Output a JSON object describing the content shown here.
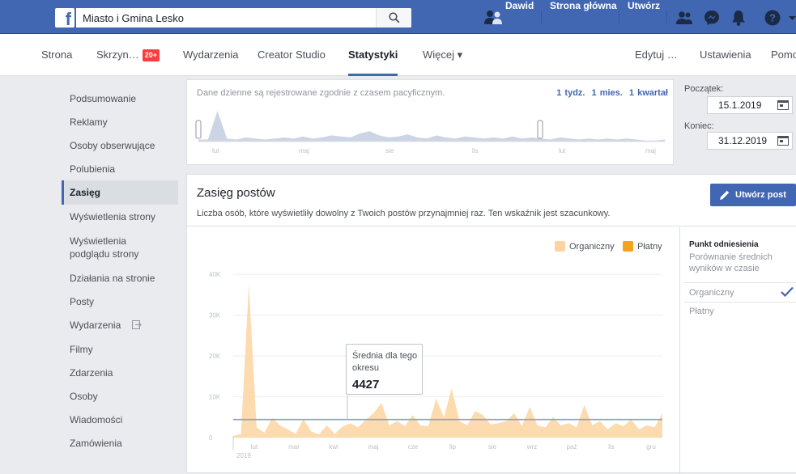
{
  "topbar": {
    "search_value": "Miasto i Gmina Lesko",
    "user_name": "Dawid",
    "home_label": "Strona główna",
    "create_label": "Utwórz",
    "icons": [
      "friends-icon",
      "messenger-icon",
      "bell-icon",
      "help-icon"
    ]
  },
  "page_nav": {
    "items": [
      {
        "label": "Strona"
      },
      {
        "label": "Skrzyn…",
        "badge": "20+"
      },
      {
        "label": "Wydarzenia"
      },
      {
        "label": "Creator Studio"
      },
      {
        "label": "Statystyki",
        "active": true
      },
      {
        "label": "Więcej ▾"
      }
    ],
    "right": [
      {
        "label": "Edytuj …"
      },
      {
        "label": "Ustawienia"
      },
      {
        "label": "Pomo"
      }
    ]
  },
  "sidebar": {
    "items": [
      {
        "label": "Podsumowanie"
      },
      {
        "label": "Reklamy"
      },
      {
        "label": "Osoby obserwujące"
      },
      {
        "label": "Polubienia"
      },
      {
        "label": "Zasięg",
        "active": true
      },
      {
        "label": "Wyświetlenia strony"
      },
      {
        "label": "Wyświetlenia podglądu strony"
      },
      {
        "label": "Działania na stronie"
      },
      {
        "label": "Posty"
      },
      {
        "label": "Wydarzenia"
      },
      {
        "label": "Filmy"
      },
      {
        "label": "Zdarzenia"
      },
      {
        "label": "Osoby"
      },
      {
        "label": "Wiadomości"
      },
      {
        "label": "Zamówienia"
      }
    ]
  },
  "range": {
    "note": "Dane dzienne są rejestrowane zgodnie z czasem pacyficznym.",
    "links": [
      "1 tydz.",
      "1 mies.",
      "1 kwartał"
    ],
    "month_labels": [
      "lut",
      "maj",
      "sie",
      "lis",
      "lut",
      "maj"
    ]
  },
  "dates": {
    "start_label": "Początek:",
    "start_value": "15.1.2019",
    "end_label": "Koniec:",
    "end_value": "31.12.2019"
  },
  "main": {
    "title": "Zasięg postów",
    "description": "Liczba osób, które wyświetliły dowolny z Twoich postów przynajmniej raz. Ten wskaźnik jest szacunkowy.",
    "create_post_label": "Utwórz post"
  },
  "benchmark": {
    "title": "Punkt odniesienia",
    "subtitle": "Porównanie średnich wyników w czasie",
    "options": [
      {
        "label": "Organiczny",
        "checked": true
      },
      {
        "label": "Płatny",
        "checked": false
      }
    ]
  },
  "tooltip": {
    "label": "Średnia dla tego okresu",
    "value": "4427"
  },
  "colors": {
    "facebook_blue": "#4267b2",
    "organic": "#fbd5a0",
    "paid": "#f5a21c",
    "average_line": "#8ea3c9"
  },
  "chart_data": {
    "type": "area",
    "series": [
      {
        "name": "Organiczny",
        "color": "#fbd5a0",
        "values": [
          400,
          900,
          37500,
          2500,
          1200,
          4800,
          3000,
          2000,
          900,
          4500,
          1500,
          800,
          3000,
          900,
          2700,
          3500,
          2500,
          4400,
          6000,
          8500,
          3000,
          4000,
          2800,
          5500,
          3000,
          2800,
          9500,
          5000,
          12000,
          4000,
          3000,
          6500,
          5500,
          3200,
          3500,
          4000,
          6000,
          2800,
          7500,
          3000,
          2500,
          5000,
          3000,
          3500,
          2500,
          8000,
          3000,
          4000,
          2000,
          3500,
          2800,
          4400,
          2000,
          3000,
          2500,
          6000
        ]
      },
      {
        "name": "Płatny",
        "color": "#f5a21c",
        "values": []
      }
    ],
    "average": 4427,
    "x_tick_labels": [
      "lut",
      "mar",
      "kwi",
      "maj",
      "cze",
      "lip",
      "sie",
      "wrz",
      "paź",
      "lis",
      "gru"
    ],
    "x_year_label": "2019",
    "y_tick_labels": [
      "0",
      "10K",
      "20K",
      "30K",
      "40K"
    ],
    "ylim": [
      0,
      42000
    ],
    "legend_position": "top-right",
    "range_selector_values": [
      2,
      2,
      30,
      3,
      2,
      4,
      3,
      2,
      3,
      4,
      3,
      5,
      3,
      4,
      6,
      5,
      4,
      8,
      10,
      6,
      4,
      5,
      7,
      4,
      3,
      6,
      4,
      3,
      5,
      4,
      3,
      4,
      3,
      5,
      3,
      4,
      3,
      2,
      4,
      3,
      2,
      3,
      2,
      3,
      2,
      3,
      2,
      1,
      1,
      2
    ]
  }
}
